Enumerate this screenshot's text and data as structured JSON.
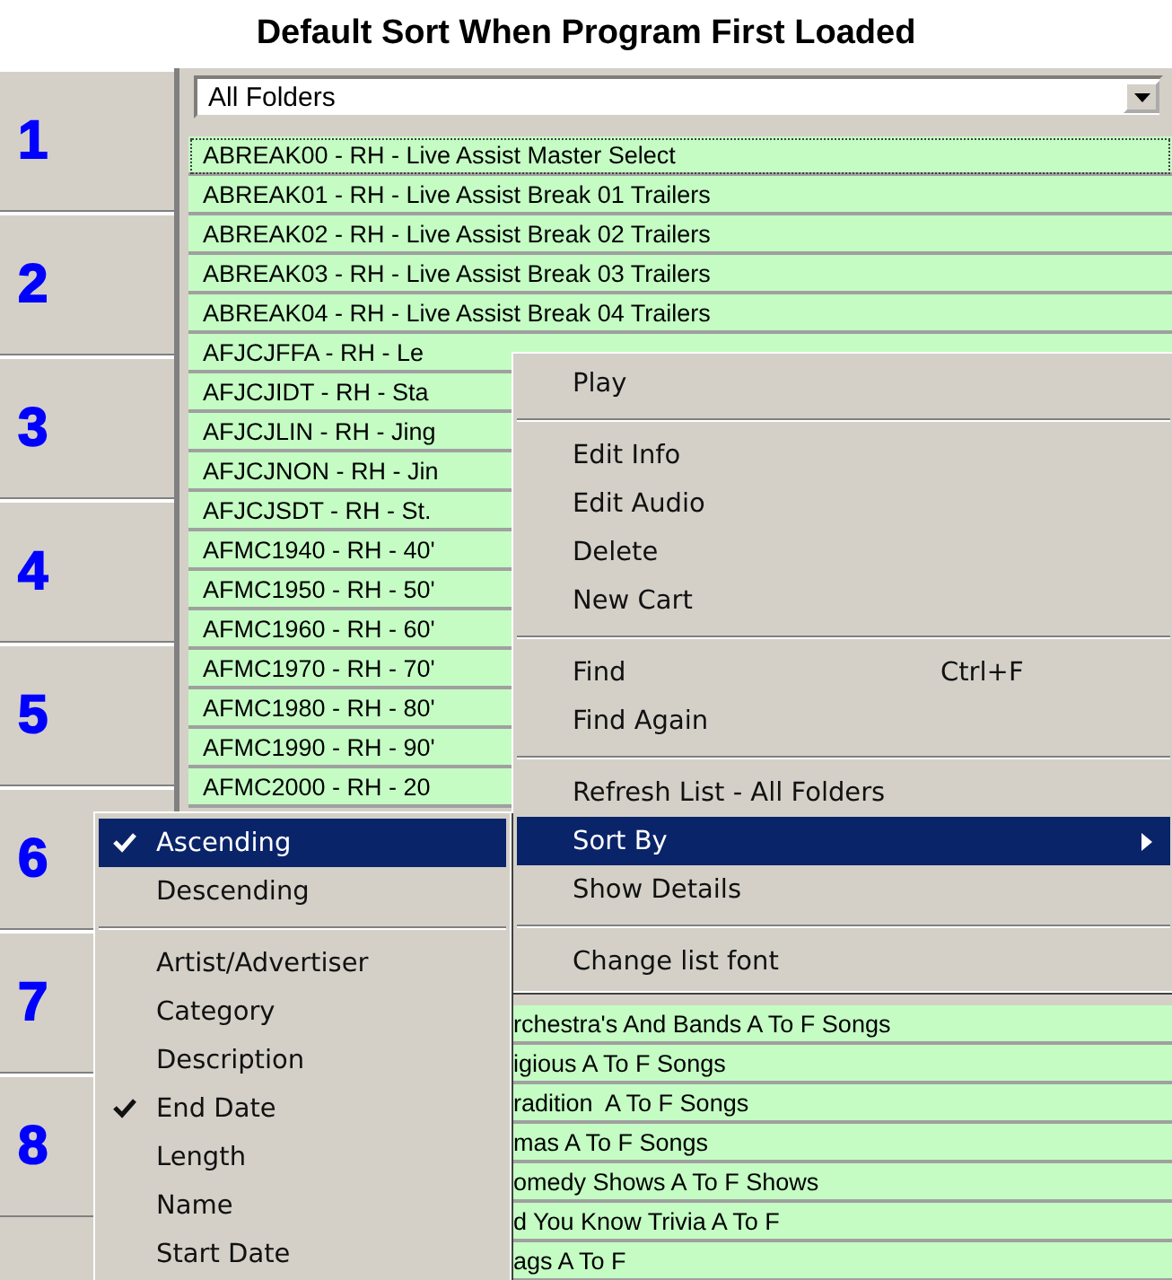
{
  "title": "Default Sort When Program First Loaded",
  "number_buttons": [
    "1",
    "2",
    "3",
    "4",
    "5",
    "6",
    "7",
    "8"
  ],
  "folder_dropdown": {
    "value": "All Folders"
  },
  "list_rows": [
    {
      "text": "ABREAK00 - RH - Live Assist Master Select",
      "focused": true
    },
    {
      "text": "ABREAK01 - RH - Live Assist Break 01 Trailers",
      "focused": false
    },
    {
      "text": "ABREAK02 - RH - Live Assist Break 02 Trailers",
      "focused": false
    },
    {
      "text": "ABREAK03 - RH - Live Assist Break 03 Trailers",
      "focused": false
    },
    {
      "text": "ABREAK04 - RH - Live Assist Break 04 Trailers",
      "focused": false
    },
    {
      "text": "AFJCJFFA - RH - Le",
      "focused": false
    },
    {
      "text": "AFJCJIDT - RH - Sta",
      "focused": false
    },
    {
      "text": "AFJCJLIN - RH - Jing",
      "focused": false
    },
    {
      "text": "AFJCJNON - RH - Jin",
      "focused": false
    },
    {
      "text": "AFJCJSDT - RH - St.",
      "focused": false
    },
    {
      "text": "AFMC1940 - RH - 40'",
      "focused": false
    },
    {
      "text": "AFMC1950 - RH - 50'",
      "focused": false
    },
    {
      "text": "AFMC1960 - RH - 60'",
      "focused": false
    },
    {
      "text": "AFMC1970 - RH - 70'",
      "focused": false
    },
    {
      "text": "AFMC1980 - RH - 80'",
      "focused": false
    },
    {
      "text": "AFMC1990 - RH - 90'",
      "focused": false
    },
    {
      "text": "AFMC2000 - RH - 20",
      "focused": false
    }
  ],
  "lower_list_rows": [
    {
      "text": "rchestra's And Bands A To F Songs",
      "focused": false
    },
    {
      "text": "igious A To F Songs",
      "focused": false
    },
    {
      "text": "radition  A To F Songs",
      "focused": false
    },
    {
      "text": "mas A To F Songs",
      "focused": false
    },
    {
      "text": "omedy Shows A To F Shows",
      "focused": false
    },
    {
      "text": "d You Know Trivia A To F",
      "focused": false
    },
    {
      "text": "ags A To F",
      "focused": false
    }
  ],
  "context_menu": [
    {
      "kind": "item",
      "label": "Play",
      "selected": false,
      "has_submenu": false
    },
    {
      "kind": "separator"
    },
    {
      "kind": "item",
      "label": "Edit Info",
      "selected": false,
      "has_submenu": false
    },
    {
      "kind": "item",
      "label": "Edit Audio",
      "selected": false,
      "has_submenu": false
    },
    {
      "kind": "item",
      "label": "Delete",
      "selected": false,
      "has_submenu": false
    },
    {
      "kind": "item",
      "label": "New Cart",
      "selected": false,
      "has_submenu": false
    },
    {
      "kind": "separator"
    },
    {
      "kind": "item",
      "label": "Find",
      "shortcut": "Ctrl+F",
      "selected": false,
      "has_submenu": false
    },
    {
      "kind": "item",
      "label": "Find Again",
      "selected": false,
      "has_submenu": false
    },
    {
      "kind": "separator"
    },
    {
      "kind": "item",
      "label": "Refresh List - All Folders",
      "selected": false,
      "has_submenu": false
    },
    {
      "kind": "item",
      "label": "Sort By",
      "selected": true,
      "has_submenu": true
    },
    {
      "kind": "item",
      "label": "Show Details",
      "selected": false,
      "has_submenu": false
    },
    {
      "kind": "separator"
    },
    {
      "kind": "item",
      "label": "Change list font",
      "selected": false,
      "has_submenu": false
    }
  ],
  "sort_submenu": [
    {
      "kind": "item",
      "label": "Ascending",
      "selected": true,
      "checked": true
    },
    {
      "kind": "item",
      "label": "Descending",
      "selected": false,
      "checked": false
    },
    {
      "kind": "separator"
    },
    {
      "kind": "item",
      "label": "Artist/Advertiser",
      "selected": false,
      "checked": false
    },
    {
      "kind": "item",
      "label": "Category",
      "selected": false,
      "checked": false
    },
    {
      "kind": "item",
      "label": "Description",
      "selected": false,
      "checked": false
    },
    {
      "kind": "item",
      "label": "End Date",
      "selected": false,
      "checked": true
    },
    {
      "kind": "item",
      "label": "Length",
      "selected": false,
      "checked": false
    },
    {
      "kind": "item",
      "label": "Name",
      "selected": false,
      "checked": false
    },
    {
      "kind": "item",
      "label": "Start Date",
      "selected": false,
      "checked": false
    }
  ]
}
